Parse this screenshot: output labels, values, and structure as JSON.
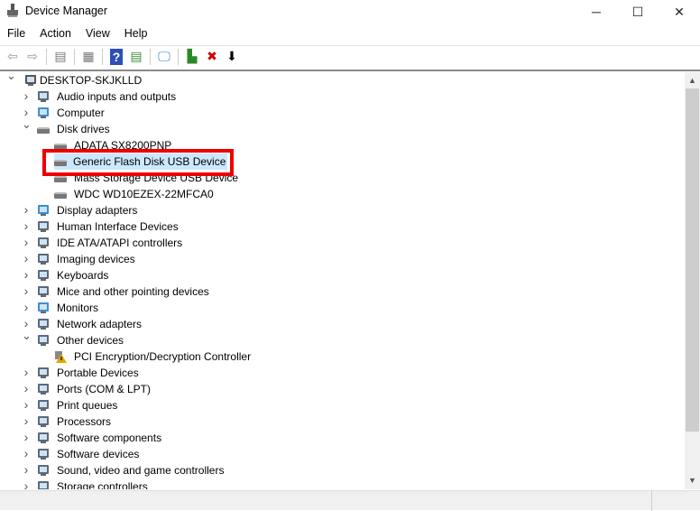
{
  "window": {
    "title": "Device Manager",
    "icons": {
      "minimize": "─",
      "maximize": "☐",
      "close": "✕"
    }
  },
  "menu": [
    "File",
    "Action",
    "View",
    "Help"
  ],
  "toolbar": [
    {
      "name": "back-icon",
      "glyph": "⇦",
      "color": "#999"
    },
    {
      "name": "forward-icon",
      "glyph": "⇨",
      "color": "#999"
    },
    {
      "sep": true
    },
    {
      "name": "show-hide-console-tree-icon",
      "glyph": "▤",
      "color": "#777"
    },
    {
      "sep": true
    },
    {
      "name": "properties-icon",
      "glyph": "▦",
      "color": "#777"
    },
    {
      "sep": true
    },
    {
      "name": "help-icon",
      "glyph": "?",
      "color": "#fff",
      "bg": "#2b4fb8"
    },
    {
      "name": "action-pane-icon",
      "glyph": "▤",
      "color": "#3a8a3a"
    },
    {
      "sep": true
    },
    {
      "name": "scan-hardware-icon",
      "glyph": "🖵",
      "color": "#2a7fc0"
    },
    {
      "sep": true
    },
    {
      "name": "update-driver-icon",
      "glyph": "▙",
      "color": "#2a8a2a"
    },
    {
      "name": "uninstall-device-icon",
      "glyph": "✖",
      "color": "#d00000"
    },
    {
      "name": "disable-device-icon",
      "glyph": "⬇",
      "color": "#000"
    }
  ],
  "tree": [
    {
      "level": 0,
      "chev": "down",
      "icon": "computer-root-icon",
      "label": "DESKTOP-SKJKLLD"
    },
    {
      "level": 1,
      "chev": "right",
      "icon": "speaker-icon",
      "label": "Audio inputs and outputs"
    },
    {
      "level": 1,
      "chev": "right",
      "icon": "monitor-icon",
      "label": "Computer"
    },
    {
      "level": 1,
      "chev": "down",
      "icon": "disk-drive-icon",
      "label": "Disk drives"
    },
    {
      "level": 2,
      "icon": "disk-drive-icon",
      "label": "ADATA SX8200PNP"
    },
    {
      "level": 2,
      "icon": "disk-drive-icon",
      "label": "Generic Flash Disk USB Device",
      "selected": true,
      "highlighted": true
    },
    {
      "level": 2,
      "icon": "disk-drive-icon",
      "label": "Mass Storage Device USB Device"
    },
    {
      "level": 2,
      "icon": "disk-drive-icon",
      "label": "WDC WD10EZEX-22MFCA0"
    },
    {
      "level": 1,
      "chev": "right",
      "icon": "display-adapter-icon",
      "label": "Display adapters"
    },
    {
      "level": 1,
      "chev": "right",
      "icon": "hid-icon",
      "label": "Human Interface Devices"
    },
    {
      "level": 1,
      "chev": "right",
      "icon": "ide-controller-icon",
      "label": "IDE ATA/ATAPI controllers"
    },
    {
      "level": 1,
      "chev": "right",
      "icon": "camera-icon",
      "label": "Imaging devices"
    },
    {
      "level": 1,
      "chev": "right",
      "icon": "keyboard-icon",
      "label": "Keyboards"
    },
    {
      "level": 1,
      "chev": "right",
      "icon": "mouse-icon",
      "label": "Mice and other pointing devices"
    },
    {
      "level": 1,
      "chev": "right",
      "icon": "monitor-icon",
      "label": "Monitors"
    },
    {
      "level": 1,
      "chev": "right",
      "icon": "network-adapter-icon",
      "label": "Network adapters"
    },
    {
      "level": 1,
      "chev": "down",
      "icon": "other-device-icon",
      "label": "Other devices"
    },
    {
      "level": 2,
      "icon": "warning-device-icon",
      "label": "PCI Encryption/Decryption Controller"
    },
    {
      "level": 1,
      "chev": "right",
      "icon": "portable-device-icon",
      "label": "Portable Devices"
    },
    {
      "level": 1,
      "chev": "right",
      "icon": "port-icon",
      "label": "Ports (COM & LPT)"
    },
    {
      "level": 1,
      "chev": "right",
      "icon": "printer-icon",
      "label": "Print queues"
    },
    {
      "level": 1,
      "chev": "right",
      "icon": "processor-icon",
      "label": "Processors"
    },
    {
      "level": 1,
      "chev": "right",
      "icon": "software-component-icon",
      "label": "Software components"
    },
    {
      "level": 1,
      "chev": "right",
      "icon": "software-device-icon",
      "label": "Software devices"
    },
    {
      "level": 1,
      "chev": "right",
      "icon": "sound-controller-icon",
      "label": "Sound, video and game controllers"
    },
    {
      "level": 1,
      "chev": "right",
      "icon": "storage-controller-icon",
      "label": "Storage controllers"
    }
  ],
  "colors": {
    "selection": "#cce8ff",
    "highlight_box": "#e00000"
  }
}
